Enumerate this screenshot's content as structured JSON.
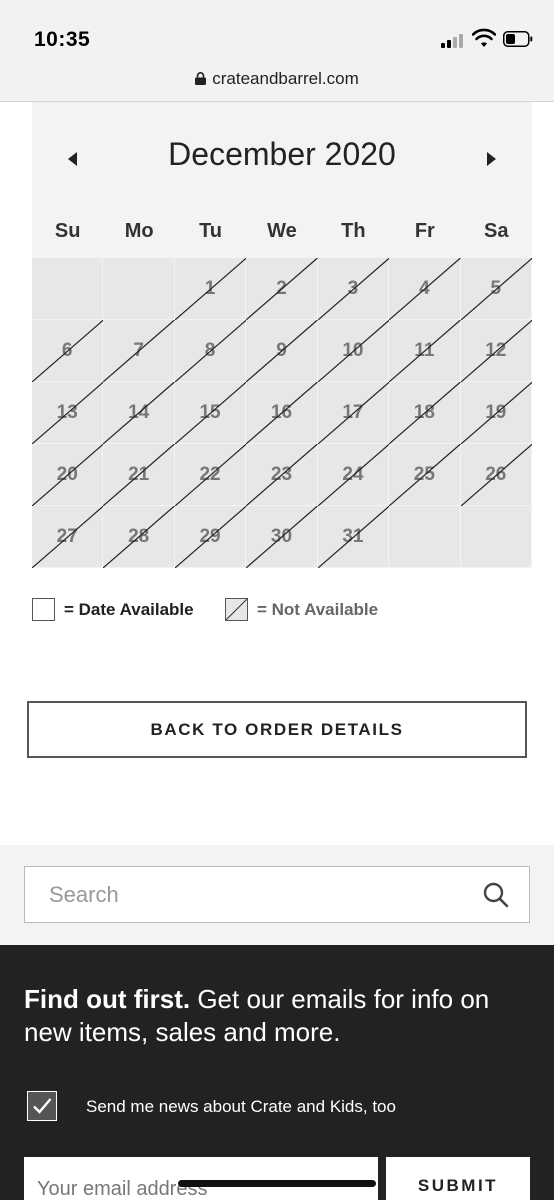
{
  "status_bar": {
    "time": "10:35"
  },
  "browser": {
    "url": "crateandbarrel.com"
  },
  "calendar": {
    "month_title": "December 2020",
    "weekdays": [
      "Su",
      "Mo",
      "Tu",
      "We",
      "Th",
      "Fr",
      "Sa"
    ],
    "first_weekday_index": 2,
    "days_in_month": 31,
    "unavailable_days": [
      1,
      2,
      3,
      4,
      5,
      6,
      7,
      8,
      9,
      10,
      11,
      12,
      13,
      14,
      15,
      16,
      17,
      18,
      19,
      20,
      21,
      22,
      23,
      24,
      25,
      26,
      27,
      28,
      29,
      30,
      31
    ]
  },
  "legend": {
    "available": "= Date Available",
    "not_available": "= Not Available"
  },
  "back_button": {
    "label": "BACK TO ORDER DETAILS"
  },
  "search": {
    "placeholder": "Search"
  },
  "newsletter": {
    "headline_bold": "Find out first.",
    "headline_rest": " Get our emails for info on new items, sales and more.",
    "checkbox_checked": true,
    "checkbox_label": "Send me news about Crate and Kids, too",
    "email_placeholder": "Your email address",
    "submit_label": "SUBMIT"
  },
  "colors": {
    "calendar_bg": "#f3f3f3",
    "unavailable_cell": "#e6e7e9",
    "footer_bg": "#222222"
  }
}
